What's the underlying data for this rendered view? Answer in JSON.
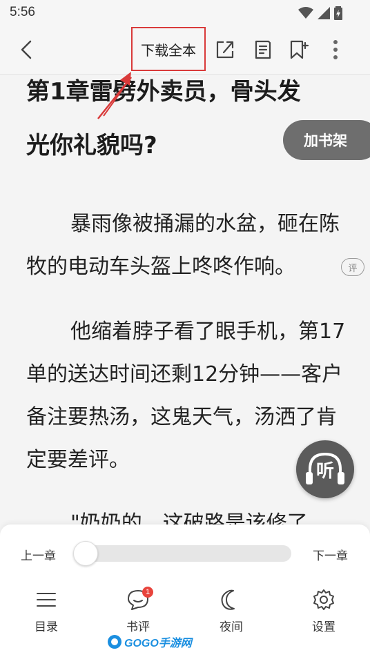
{
  "status_bar": {
    "time": "5:56"
  },
  "toolbar": {
    "download_label": "下载全本",
    "icons": [
      "back-icon",
      "share-icon",
      "notes-icon",
      "bookmark-icon",
      "more-icon"
    ]
  },
  "reader": {
    "chapter_title_line1": "第1章雷劈外卖员，骨头发",
    "chapter_title_line2": "光你礼貌吗?",
    "add_shelf_label": "加书架",
    "comment_label": "评",
    "listen_label": "听",
    "paragraphs": [
      "暴雨像被捅漏的水盆，砸在陈牧的电动车头盔上咚咚作响。",
      "他缩着脖子看了眼手机，第17单的送达时间还剩12分钟——客户备注要热汤，这鬼天气，汤洒了肯定要差评。",
      "\"奶奶的，这破路是该修了"
    ]
  },
  "bottom_panel": {
    "prev_chapter": "上一章",
    "next_chapter": "下一章",
    "progress_fraction": 0.0,
    "nav": [
      {
        "label": "目录",
        "icon": "list-icon"
      },
      {
        "label": "书评",
        "icon": "chat-icon",
        "badge": "1"
      },
      {
        "label": "夜间",
        "icon": "moon-icon"
      },
      {
        "label": "设置",
        "icon": "gear-icon"
      }
    ]
  },
  "watermark": {
    "text": "GOGO手游网"
  },
  "colors": {
    "annotation_red": "#d93a3a",
    "shelf_gray": "#6e6e6e",
    "badge_red": "#e8443c"
  }
}
